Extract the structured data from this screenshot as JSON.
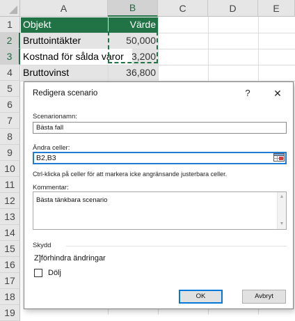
{
  "sheet": {
    "columns": [
      "A",
      "B",
      "C",
      "D",
      "E"
    ],
    "rows": [
      "1",
      "2",
      "3",
      "4",
      "5",
      "6",
      "7",
      "8",
      "9",
      "10",
      "11",
      "12",
      "13",
      "14",
      "15",
      "16",
      "17",
      "18",
      "19"
    ],
    "header_row": {
      "label": "Objekt",
      "value": "Värde"
    },
    "data": [
      {
        "label": "Bruttointäkter",
        "value": "50,000"
      },
      {
        "label": "Kostnad för sålda varor",
        "value": "13,200"
      },
      {
        "label": "Bruttovinst",
        "value": "36,800"
      }
    ],
    "colors": {
      "header_fill": "#217346",
      "header_text": "#ffffff",
      "marquee": "#217346",
      "shade": "#e4e4e4"
    }
  },
  "dialog": {
    "title": "Redigera scenario",
    "help_label": "?",
    "close_label": "✕",
    "scenario_name_label": "Scenarionamn:",
    "scenario_name_value": "Bästa fall",
    "changing_cells_label": "Ändra celler:",
    "changing_cells_value": "B2,B3",
    "changing_cells_hint": "Ctrl-klicka på celler för att markera icke angränsande justerbara celler.",
    "comment_label": "Kommentar:",
    "comment_value": "Bästa tänkbara scenario",
    "protection_label": "Skydd",
    "prevent_changes_label": "Z]förhindra ändringar",
    "hide_label": "Dölj",
    "ok_label": "OK",
    "cancel_label": "Avbryt",
    "icons": {
      "range_selector": "range-selector-icon",
      "scroll_up": "scroll-up-icon",
      "scroll_down": "scroll-down-icon"
    }
  }
}
